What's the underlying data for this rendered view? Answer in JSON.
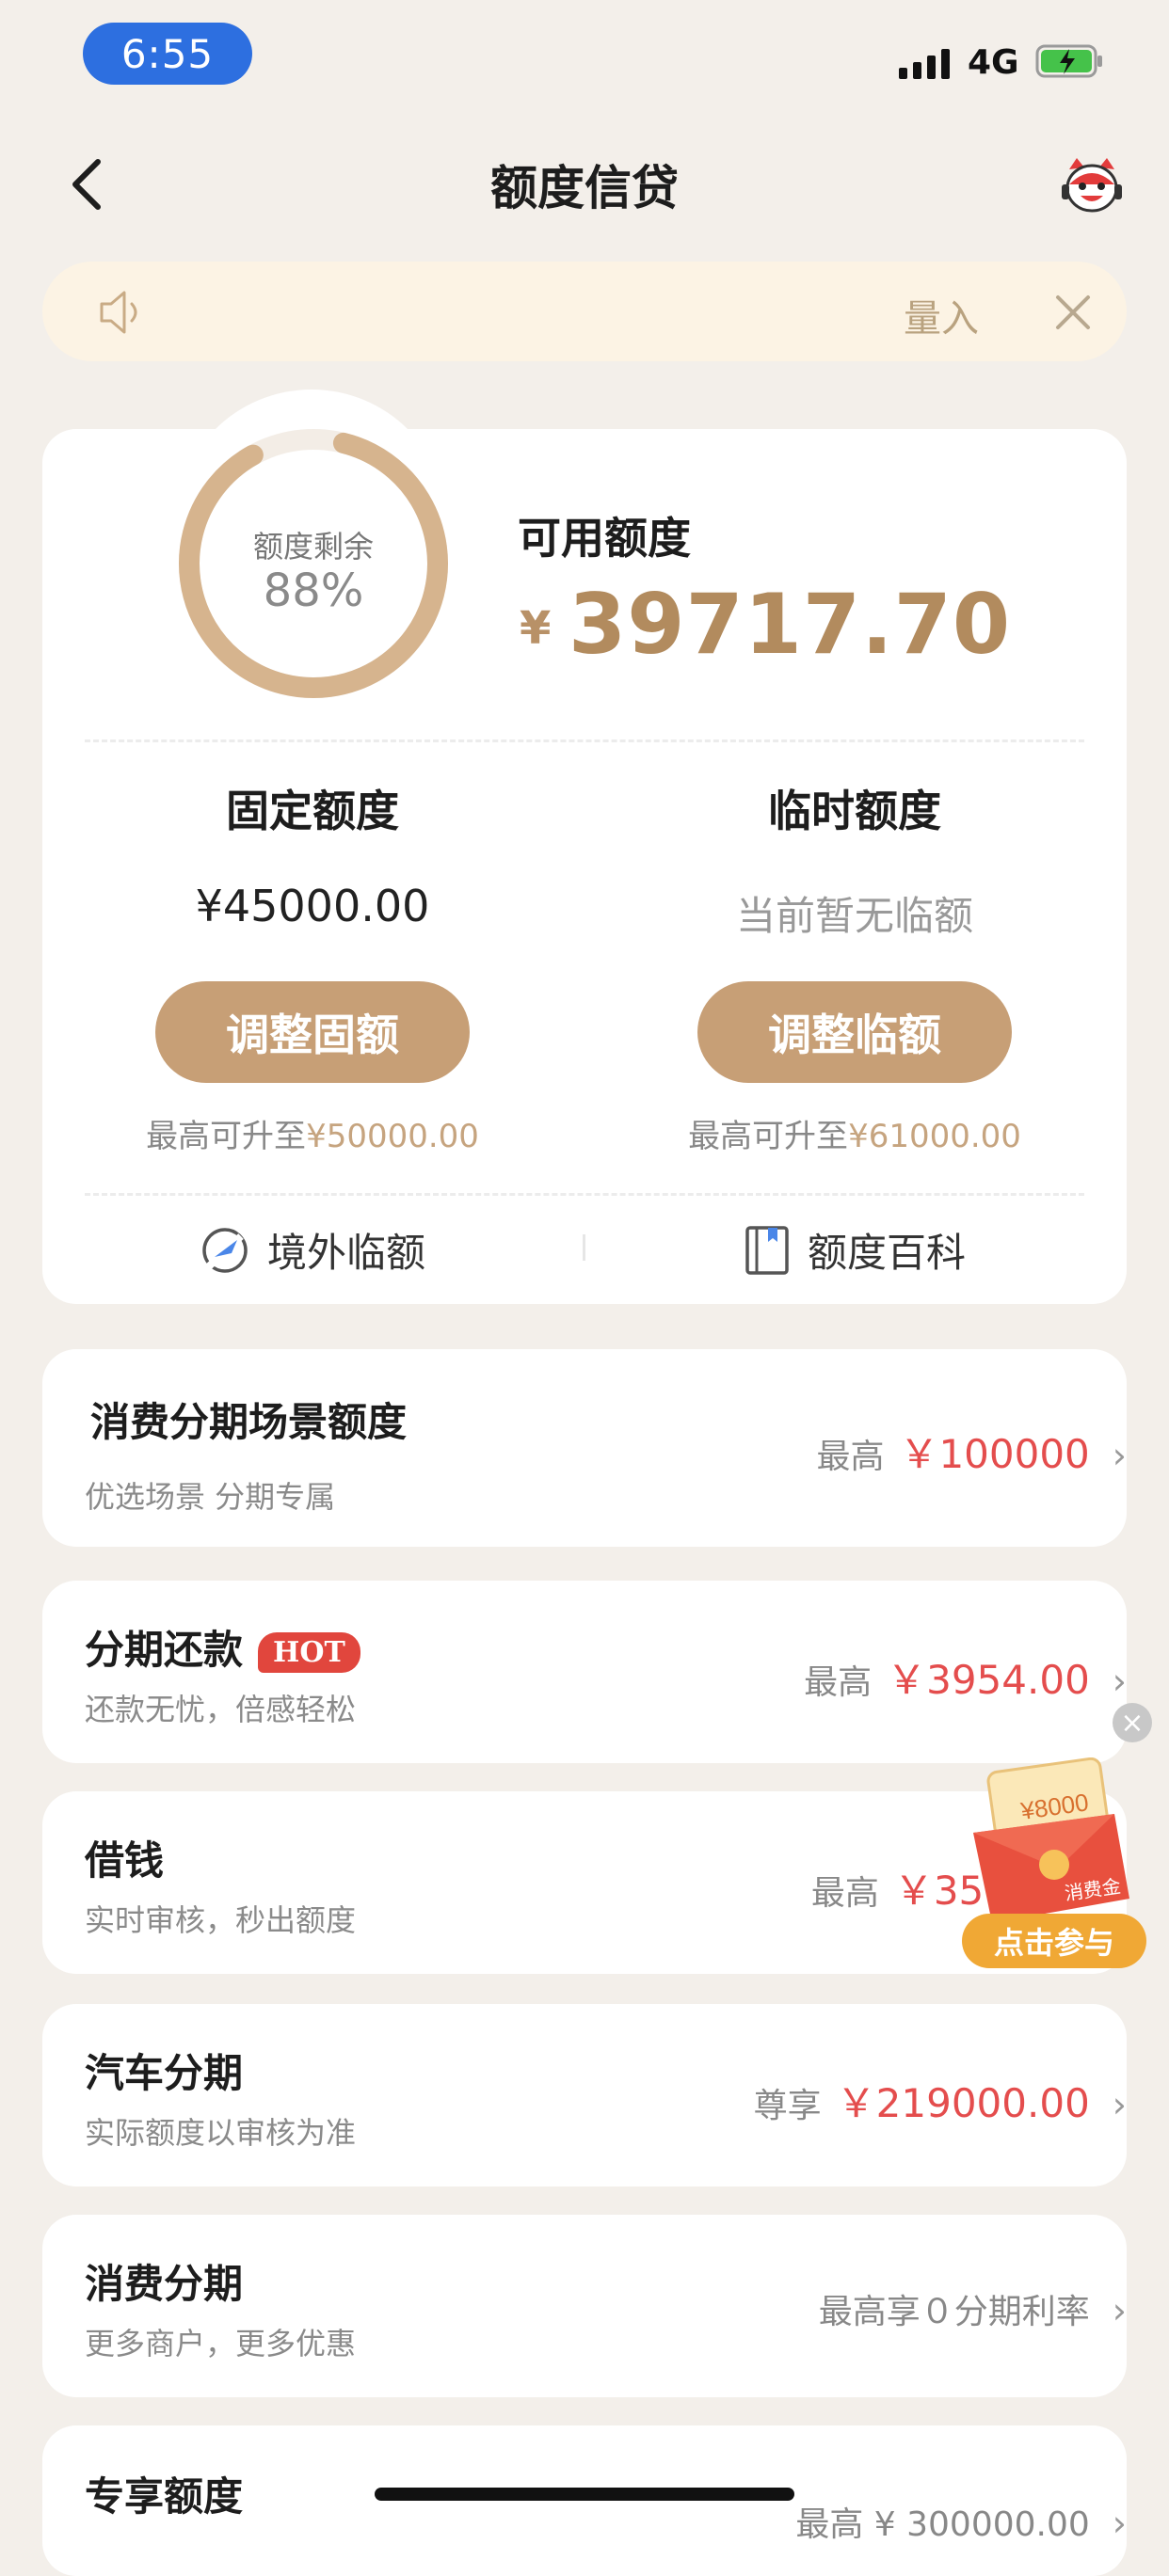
{
  "status_bar": {
    "time": "6:55",
    "network": "4G"
  },
  "nav": {
    "title": "额度信贷"
  },
  "notice": {
    "text": "量入"
  },
  "quota": {
    "ring_label": "额度剩余",
    "ring_percent_text": "88%",
    "ring_fraction": 0.88,
    "available_label": "可用额度",
    "currency_symbol": "¥",
    "available_amount": "39717.70",
    "fixed": {
      "title": "固定额度",
      "value": "¥45000.00",
      "button": "调整固额",
      "max_prefix": "最高可升至",
      "max_value": "¥50000.00"
    },
    "temp": {
      "title": "临时额度",
      "value": "当前暂无临额",
      "button": "调整临额",
      "max_prefix": "最高可升至",
      "max_value": "¥61000.00"
    },
    "links": {
      "overseas": "境外临额",
      "wiki": "额度百科"
    }
  },
  "rows": [
    {
      "title": "消费分期场景额度",
      "sub": "优选场景 分期专属",
      "prefix": "最高",
      "amount": "￥100000"
    },
    {
      "title": "分期还款",
      "badge": "HOT",
      "sub": "还款无忧，倍感轻松",
      "prefix": "最高",
      "amount": "￥3954.00"
    },
    {
      "title": "借钱",
      "sub": "实时审核，秒出额度",
      "prefix": "最高",
      "amount": "￥350"
    },
    {
      "title": "汽车分期",
      "sub": "实际额度以审核为准",
      "prefix": "尊享",
      "amount": "￥219000.00"
    },
    {
      "title": "消费分期",
      "sub": "更多商户，更多优惠",
      "prefix": "最高享０分期利率",
      "amount": ""
    },
    {
      "title": "专享额度",
      "sub": "",
      "prefix": "",
      "amount": "最高 ¥ 300000.00"
    }
  ],
  "promo": {
    "amount": "¥8000",
    "label": "消费金",
    "button": "点击参与"
  },
  "colors": {
    "accent": "#c79f76",
    "amount_red": "#e44d4d",
    "gold_text": "#b28b5e"
  }
}
